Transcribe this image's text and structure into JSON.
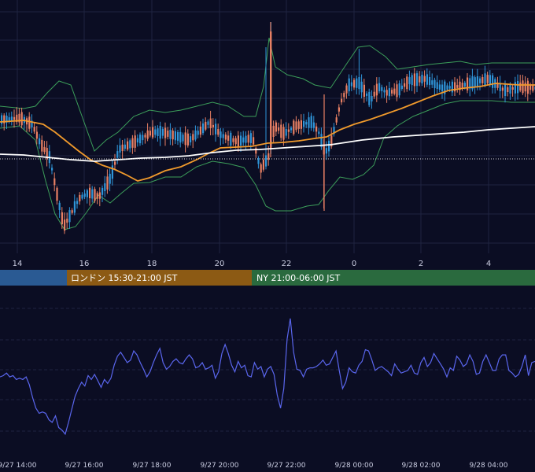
{
  "colors": {
    "background": "#0b0d23",
    "grid": "#1f2340",
    "candle_up": "#2f95d8",
    "candle_down": "#e88064",
    "sma_short": "#f09a2c",
    "sma_long": "#ffffff",
    "bollinger": "#3c9e5a",
    "oscillator": "#5a66ee",
    "dotted_level": "#d8d8d8",
    "session_tokyo": "#2a5a93",
    "session_london": "#8c5a14",
    "session_ny": "#2a6a3e"
  },
  "sessions": [
    {
      "label": "",
      "color": "#2a5a93"
    },
    {
      "label": "ロンドン 15:30-21:00 JST",
      "color": "#8c5a14"
    },
    {
      "label": "NY 21:00-06:00 JST",
      "color": "#2a6a3e"
    }
  ],
  "chart_data": [
    {
      "type": "candlestick",
      "title": "",
      "x_tick_labels": [
        "14",
        "16",
        "18",
        "20",
        "22",
        "0",
        "2",
        "4"
      ],
      "indicators": [
        "SMA short (orange)",
        "SMA long (white)",
        "Bollinger Bands (green)"
      ],
      "y_axis_visible": false,
      "grid": true,
      "note_values": "price values not printed; candle shape and indicator paths approximate the visual"
    },
    {
      "type": "line",
      "title": "",
      "x_tick_labels": [
        "9/27 14:00",
        "9/27 16:00",
        "9/27 18:00",
        "9/27 20:00",
        "9/27 22:00",
        "9/28 00:00",
        "9/28 02:00",
        "9/28 04:00"
      ],
      "grid": true,
      "series": [
        {
          "values": [
            0.49,
            0.5,
            0.52,
            0.49,
            0.5,
            0.47,
            0.48,
            0.47,
            0.49,
            0.43,
            0.33,
            0.25,
            0.21,
            0.22,
            0.21,
            0.16,
            0.14,
            0.19,
            0.1,
            0.08,
            0.05,
            0.14,
            0.24,
            0.34,
            0.4,
            0.45,
            0.42,
            0.5,
            0.47,
            0.51,
            0.46,
            0.41,
            0.47,
            0.44,
            0.48,
            0.58,
            0.65,
            0.68,
            0.64,
            0.6,
            0.62,
            0.69,
            0.66,
            0.6,
            0.55,
            0.49,
            0.53,
            0.6,
            0.66,
            0.71,
            0.6,
            0.55,
            0.57,
            0.61,
            0.63,
            0.6,
            0.59,
            0.63,
            0.66,
            0.63,
            0.56,
            0.57,
            0.6,
            0.55,
            0.56,
            0.58,
            0.48,
            0.53,
            0.67,
            0.74,
            0.67,
            0.58,
            0.53,
            0.61,
            0.56,
            0.58,
            0.5,
            0.49,
            0.6,
            0.55,
            0.57,
            0.49,
            0.55,
            0.57,
            0.51,
            0.35,
            0.25,
            0.4,
            0.78,
            0.94,
            0.68,
            0.55,
            0.54,
            0.49,
            0.55,
            0.56,
            0.56,
            0.57,
            0.59,
            0.62,
            0.58,
            0.59,
            0.64,
            0.69,
            0.54,
            0.4,
            0.45,
            0.56,
            0.53,
            0.52,
            0.58,
            0.61,
            0.7,
            0.69,
            0.62,
            0.54,
            0.56,
            0.57,
            0.55,
            0.53,
            0.5,
            0.59,
            0.55,
            0.52,
            0.53,
            0.54,
            0.58,
            0.52,
            0.51,
            0.6,
            0.64,
            0.57,
            0.6,
            0.67,
            0.63,
            0.59,
            0.55,
            0.49,
            0.56,
            0.54,
            0.65,
            0.62,
            0.57,
            0.59,
            0.66,
            0.61,
            0.51,
            0.52,
            0.61,
            0.66,
            0.6,
            0.54,
            0.54,
            0.63,
            0.66,
            0.66,
            0.54,
            0.52,
            0.49,
            0.51,
            0.57,
            0.66,
            0.5,
            0.6,
            0.61
          ]
        }
      ]
    }
  ]
}
